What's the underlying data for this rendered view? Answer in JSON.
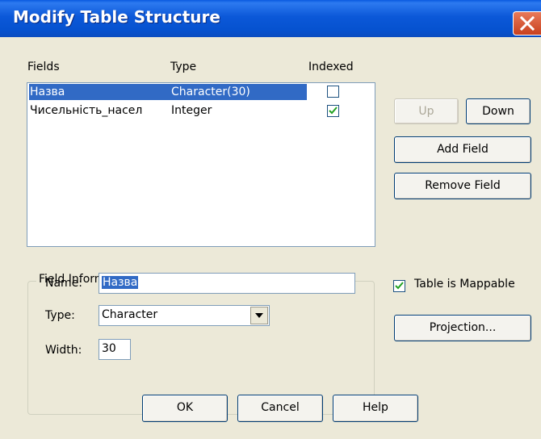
{
  "window": {
    "title": "Modify Table Structure",
    "close_icon": "close-icon"
  },
  "fields_list": {
    "headers": {
      "fields": "Fields",
      "type": "Type",
      "indexed": "Indexed"
    },
    "rows": [
      {
        "name": "Назва",
        "type": "Character(30)",
        "indexed": false,
        "selected": true
      },
      {
        "name": "Чисельність_насел",
        "type": "Integer",
        "indexed": true,
        "selected": false
      }
    ]
  },
  "buttons": {
    "up": "Up",
    "down": "Down",
    "add_field": "Add Field",
    "remove_field": "Remove Field",
    "projection": "Projection...",
    "ok": "OK",
    "cancel": "Cancel",
    "help": "Help"
  },
  "field_info": {
    "legend": "Field Information",
    "name_label": "Name:",
    "name_value": "Назва",
    "type_label": "Type:",
    "type_value": "Character",
    "width_label": "Width:",
    "width_value": "30"
  },
  "mappable": {
    "label": "Table is Mappable",
    "checked": true
  },
  "colors": {
    "titlebar": "#0a58d8",
    "selection": "#316ac5",
    "dialog_bg": "#ece9d8",
    "close": "#d85a33"
  }
}
